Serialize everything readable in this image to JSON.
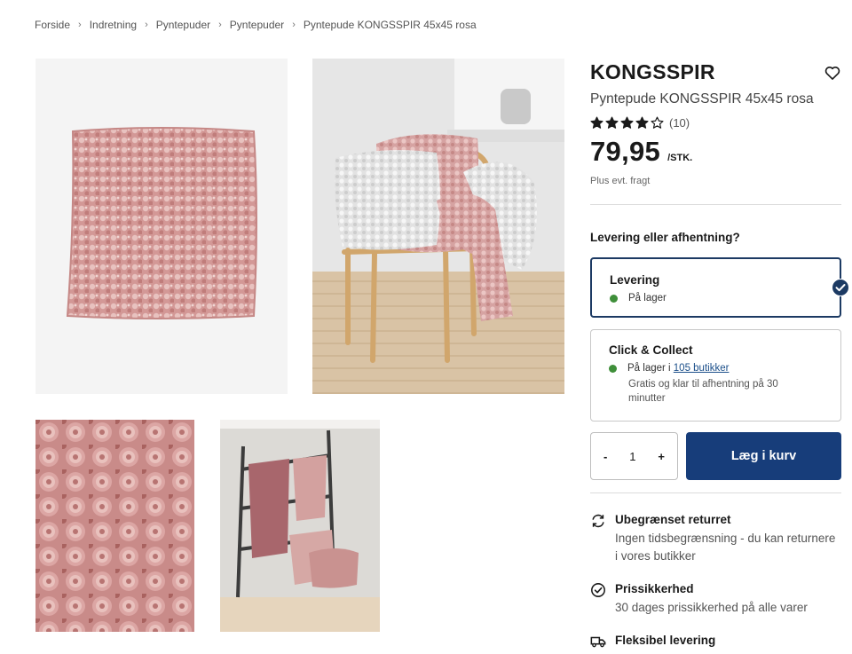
{
  "breadcrumb": [
    "Forside",
    "Indretning",
    "Pyntepuder",
    "Pyntepuder",
    "Pyntepude KONGSSPIR 45x45 rosa"
  ],
  "product": {
    "brand": "KONGSSPIR",
    "subtitle": "Pyntepude KONGSSPIR 45x45 rosa",
    "rating": 4,
    "rating_count": "(10)",
    "price": "79,95",
    "unit": "/STK.",
    "freight": "Plus evt. fragt"
  },
  "delivery": {
    "question": "Levering eller afhentning?",
    "options": [
      {
        "title": "Levering",
        "status": "På lager",
        "selected": true
      },
      {
        "title": "Click & Collect",
        "status_prefix": "På lager i ",
        "status_link": "105 butikker",
        "note": "Gratis og klar til afhentning på 30 minutter",
        "selected": false
      }
    ]
  },
  "cart": {
    "minus": "-",
    "quantity": "1",
    "plus": "+",
    "button": "Læg i kurv"
  },
  "features": [
    {
      "icon": "return-icon",
      "title": "Ubegrænset returret",
      "desc": "Ingen tidsbegrænsning - du kan returnere i vores butikker"
    },
    {
      "icon": "price-check-icon",
      "title": "Prissikkerhed",
      "desc": "30 dages prissikkerhed på alle varer"
    },
    {
      "icon": "truck-icon",
      "title": "Fleksibel levering",
      "desc": ""
    }
  ],
  "colors": {
    "accent": "#173d7a",
    "selected_border": "#1c3a63",
    "stock_green": "#3f8f3a",
    "cushion_pink": "#d49a98"
  }
}
